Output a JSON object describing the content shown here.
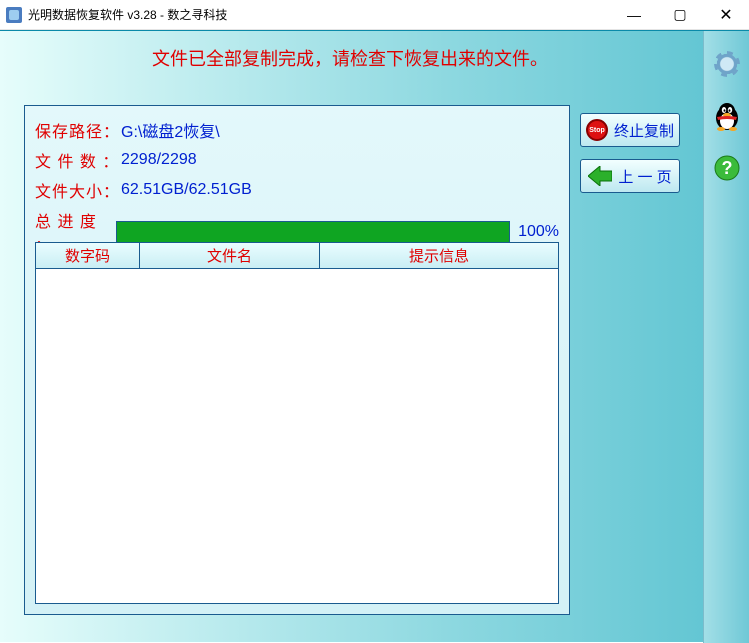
{
  "window": {
    "title": "光明数据恢复软件 v3.28 - 数之寻科技"
  },
  "banner": "文件已全部复制完成，请检查下恢复出来的文件。",
  "info": {
    "save_path_label": "保存路径：",
    "save_path_value": "G:\\磁盘2恢复\\",
    "file_count_label": "文 件 数 ：",
    "file_count_value": "2298/2298",
    "file_size_label": "文件大小：",
    "file_size_value": "62.51GB/62.51GB",
    "progress_label": "总 进 度 ：",
    "progress_pct": "100%",
    "progress_fill_width": "100%"
  },
  "grid": {
    "col1": "数字码",
    "col2": "文件名",
    "col3": "提示信息"
  },
  "buttons": {
    "stop": "终止复制",
    "prev": "上 一 页"
  },
  "sidebar": {
    "settings": "settings",
    "qq": "qq",
    "help": "help"
  }
}
